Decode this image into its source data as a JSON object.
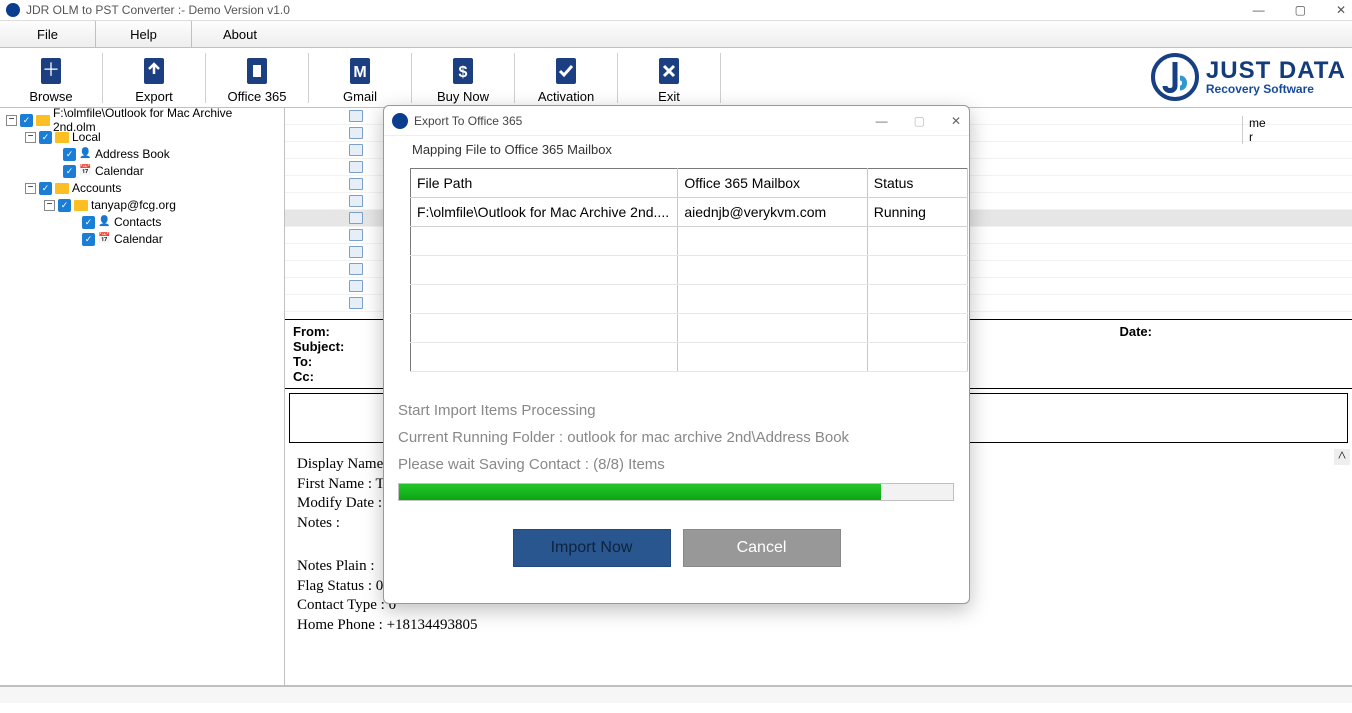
{
  "window": {
    "title": "JDR OLM to PST Converter :- Demo Version v1.0"
  },
  "menubar": {
    "items": [
      "File",
      "Help",
      "About"
    ]
  },
  "toolbar": {
    "items": [
      {
        "label": "Browse"
      },
      {
        "label": "Export"
      },
      {
        "label": "Office 365"
      },
      {
        "label": "Gmail"
      },
      {
        "label": "Buy Now"
      },
      {
        "label": "Activation"
      },
      {
        "label": "Exit"
      }
    ]
  },
  "logo": {
    "line1": "JUST DATA",
    "line2": "Recovery Software"
  },
  "tree": {
    "root": "F:\\olmfile\\Outlook for Mac Archive 2nd.olm",
    "local": "Local",
    "addressbook": "Address Book",
    "calendar": "Calendar",
    "accounts": "Accounts",
    "email": "tanyap@fcg.org",
    "contacts": "Contacts",
    "calendar2": "Calendar"
  },
  "head_right": {
    "a": "me",
    "b": "r"
  },
  "headers": {
    "from": "From:",
    "subject": "Subject:",
    "to": "To:",
    "cc": "Cc:",
    "date": "Date:"
  },
  "details": {
    "display_name": "Display Name",
    "first_name": "First Name : T",
    "modify_date": "Modify Date :",
    "notes": "Notes :",
    "notes_plain": "Notes Plain :",
    "flag_status": "Flag Status : 0",
    "contact_type": "Contact Type : 0",
    "home_phone": "Home Phone : +18134493805"
  },
  "modal": {
    "title": "Export To Office 365",
    "group_legend": "Mapping File to Office 365 Mailbox",
    "cols": {
      "file_path": "File Path",
      "mailbox": "Office 365 Mailbox",
      "status": "Status"
    },
    "row": {
      "file_path": "F:\\olmfile\\Outlook for Mac Archive 2nd....",
      "mailbox": "aiednjb@verykvm.com",
      "status": "Running"
    },
    "line1": "Start Import Items Processing",
    "line2": "Current Running Folder : outlook for mac archive 2nd\\Address Book",
    "line3": "Please wait Saving Contact : (8/8) Items",
    "btn_import": "Import Now",
    "btn_cancel": "Cancel",
    "progress_pct": 87
  }
}
